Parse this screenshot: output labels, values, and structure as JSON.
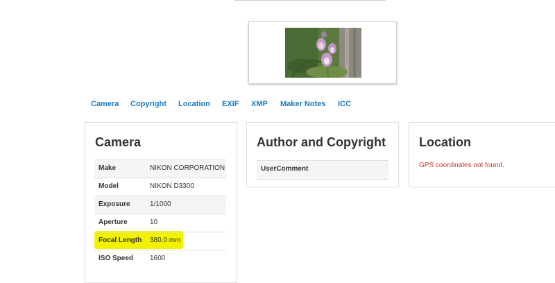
{
  "image_preview": {
    "alt": "foxglove flower thumbnail"
  },
  "tabs": [
    {
      "label": "Camera"
    },
    {
      "label": "Copyright"
    },
    {
      "label": "Location"
    },
    {
      "label": "EXIF"
    },
    {
      "label": "XMP"
    },
    {
      "label": "Maker Notes"
    },
    {
      "label": "ICC"
    }
  ],
  "camera": {
    "title": "Camera",
    "rows": [
      {
        "key": "Make",
        "value": "NIKON CORPORATION"
      },
      {
        "key": "Model",
        "value": "NIKON D3300"
      },
      {
        "key": "Exposure",
        "value": "1/1000"
      },
      {
        "key": "Aperture",
        "value": "10"
      },
      {
        "key": "Focal Length",
        "value": "380.0 mm"
      },
      {
        "key": "ISO Speed",
        "value": "1600"
      }
    ]
  },
  "copyright": {
    "title": "Author and Copyright",
    "rows": [
      {
        "key": "UserComment",
        "value": ""
      }
    ]
  },
  "location": {
    "title": "Location",
    "message": "GPS coordinates not found."
  },
  "colors": {
    "link": "#1a7bbf",
    "highlight": "#f2f200",
    "error": "#c9302c",
    "row_shade": "#f5f5f5"
  }
}
